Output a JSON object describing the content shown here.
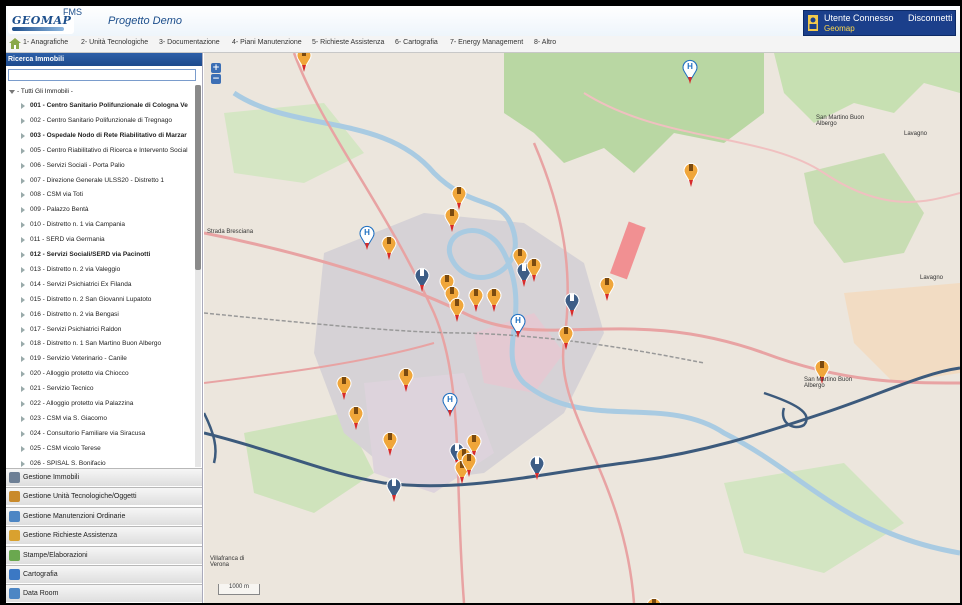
{
  "header": {
    "logo_text": "GEOMAP",
    "logo_sub": "FMS",
    "project_title": "Progetto Demo",
    "user_label": "Utente Connesso",
    "user_name": "Geomap",
    "logout_label": "Disconnetti",
    "accent_color": "#1b3f8b"
  },
  "menu": {
    "home_icon": "home-icon",
    "items": [
      "1- Anagrafiche",
      "2- Unità Tecnologiche",
      "3- Documentazione",
      "4- Piani Manutenzione",
      "5- Richieste Assistenza",
      "6- Cartografia",
      "7- Energy Management",
      "8- Altro"
    ]
  },
  "sidebar": {
    "panel_title": "Ricerca Immobili",
    "search_placeholder": "",
    "tree_root": "- Tutti Gli Immobili -",
    "tree_items": [
      {
        "label": "001 - Centro Sanitario Polifunzionale di Cologna Ve",
        "bold": true
      },
      {
        "label": "002 - Centro Sanitario Polifunzionale di Tregnago",
        "bold": false
      },
      {
        "label": "003 - Ospedale Nodo di Rete Riabilitativo di Marzar",
        "bold": true
      },
      {
        "label": "005 - Centro Riabilitativo di Ricerca e Intervento Social",
        "bold": false
      },
      {
        "label": "006 - Servizi Sociali - Porta Palio",
        "bold": false
      },
      {
        "label": "007 - Direzione Generale ULSS20 - Distretto 1",
        "bold": false
      },
      {
        "label": "008 - CSM via Toti",
        "bold": false
      },
      {
        "label": "009 - Palazzo Bentà",
        "bold": false
      },
      {
        "label": "010 - Distretto n. 1 via Campania",
        "bold": false
      },
      {
        "label": "011 - SERD via Germania",
        "bold": false
      },
      {
        "label": "012 - Servizi Sociali/SERD via Pacinotti",
        "bold": true
      },
      {
        "label": "013 - Distretto n. 2 via Valeggio",
        "bold": false
      },
      {
        "label": "014 - Servizi Psichiatrici Ex Filanda",
        "bold": false
      },
      {
        "label": "015 - Distretto n. 2 San Giovanni Lupatoto",
        "bold": false
      },
      {
        "label": "016 - Distretto n. 2 via Bengasi",
        "bold": false
      },
      {
        "label": "017 - Servizi Psichiatrici Raldon",
        "bold": false
      },
      {
        "label": "018 - Distretto n. 1 San Martino Buon Albergo",
        "bold": false
      },
      {
        "label": "019 - Servizio Veterinario - Canile",
        "bold": false
      },
      {
        "label": "020 - Alloggio protetto via Chiocco",
        "bold": false
      },
      {
        "label": "021 - Servizio Tecnico",
        "bold": false
      },
      {
        "label": "022 - Alloggio protetto via Palazzina",
        "bold": false
      },
      {
        "label": "023 - CSM via S. Giacomo",
        "bold": false
      },
      {
        "label": "024 - Consultorio Familiare via Siracusa",
        "bold": false
      },
      {
        "label": "025 - CSM vicolo Terese",
        "bold": false
      },
      {
        "label": "026 - SPISAL S. Bonifacio",
        "bold": false
      }
    ],
    "accordion": [
      {
        "label": "Gestione Immobili",
        "icon": "building-icon",
        "color": "#6d7f95"
      },
      {
        "label": "Gestione Unità Tecnologiche/Oggetti",
        "icon": "gear-icon",
        "color": "#c98a2b"
      },
      {
        "label": "Gestione Manutenzioni Ordinarie",
        "icon": "calendar-icon",
        "color": "#4d86c4"
      },
      {
        "label": "Gestione Richieste Assistenza",
        "icon": "wrench-icon",
        "color": "#d9a12f"
      },
      {
        "label": "Stampe/Elaborazioni",
        "icon": "print-icon",
        "color": "#6aa84f"
      },
      {
        "label": "Cartografia",
        "icon": "map-icon",
        "color": "#3b78c4"
      },
      {
        "label": "Data Room",
        "icon": "folder-icon",
        "color": "#4d86c4"
      }
    ]
  },
  "map": {
    "zoom_in": "+",
    "zoom_out": "−",
    "scale_label": "1000 m",
    "labels": {
      "san_martino_nord": "San Martino Buon\nAlbergo",
      "lavagno_n": "Lavagno",
      "lavagno_e": "Lavagno",
      "san_martino": "San Martino Buon\nAlbergo",
      "villafranca": "Villafranca di\nVerona",
      "strada_bresciana": "Strada Bresciana"
    },
    "colors": {
      "marker_orange": "#f0a63a",
      "marker_blue": "#3d5d86",
      "marker_hospital": "#1e6fc0",
      "road": "#e8a5a5",
      "highway": "#3c5a7c",
      "river": "#a7c9df",
      "green": "#aed39a"
    }
  }
}
